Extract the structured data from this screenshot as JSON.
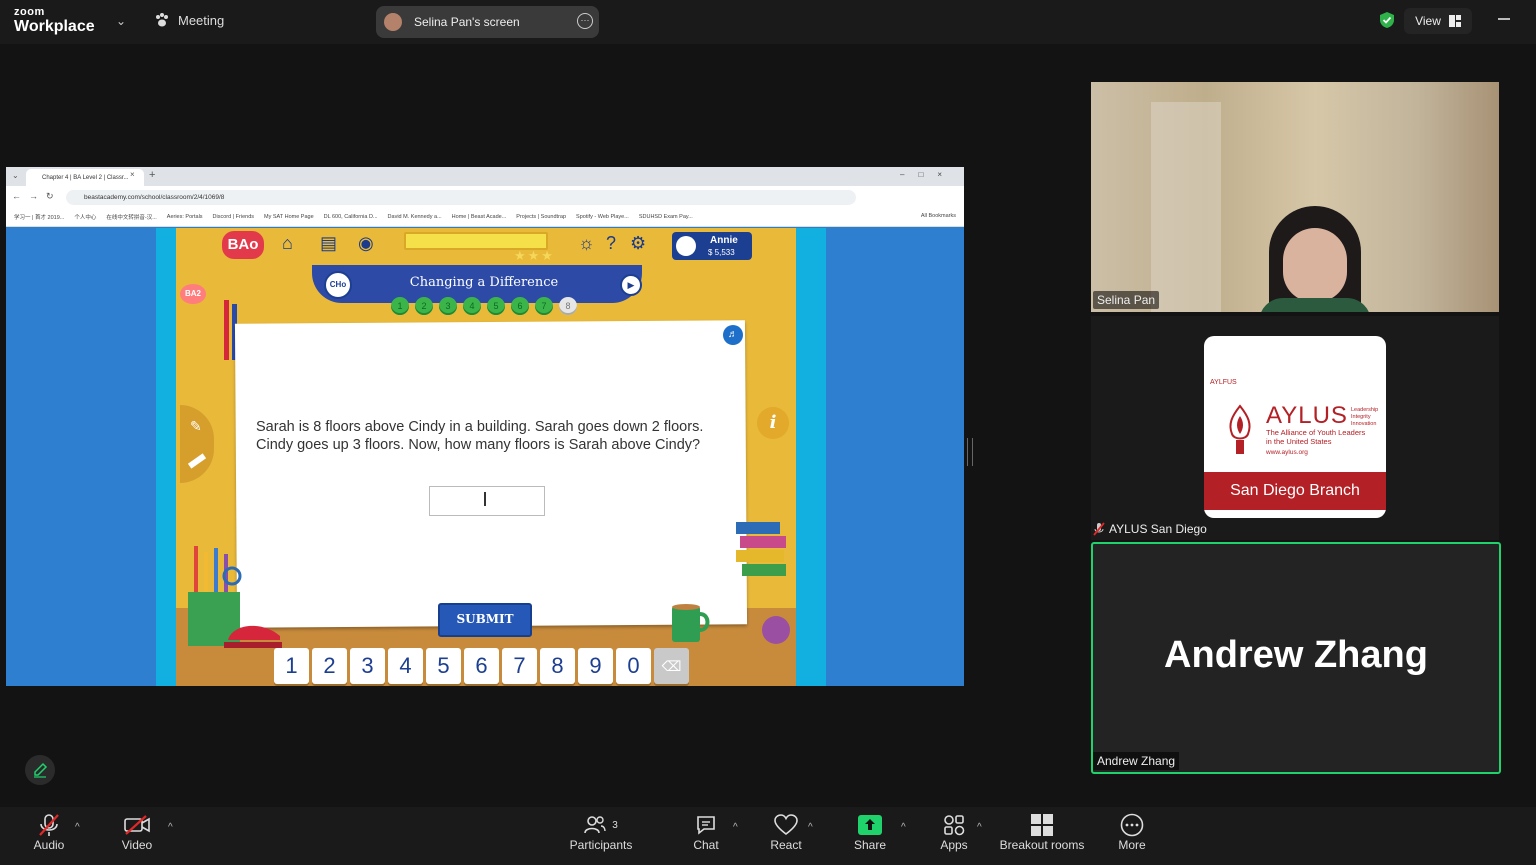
{
  "app": {
    "logo_line1": "zoom",
    "logo_line2": "Workplace"
  },
  "topbar": {
    "meeting_label": "Meeting",
    "screen_share_label": "Selina Pan's screen",
    "view_label": "View",
    "shield_color": "#2fb24a"
  },
  "browser": {
    "tab_title": "Chapter 4 | BA Level 2 | Classr...",
    "url": "beastacademy.com/school/classroom/2/4/1069/8",
    "bookmarks": [
      "学习一 | 首才 2019...",
      "个人中心",
      "在线中文转拼音-汉...",
      "Aeries: Portals",
      "Discord | Friends",
      "My SAT Home Page",
      "DL 600, California D...",
      "David M. Kennedy a...",
      "Home | Beast Acade...",
      "Projects | Soundtrap",
      "Spotify - Web Playe...",
      "SDUHSD Exam Pay..."
    ],
    "all_bookmarks": "All Bookmarks"
  },
  "game": {
    "logo": "BAo",
    "logo2": "BA2",
    "user_name": "Annie",
    "user_money": "$ 5,533",
    "chapter_badge": "CHo",
    "lesson_title": "Changing a Difference",
    "progress_dots": [
      "1",
      "2",
      "3",
      "4",
      "5",
      "6",
      "7",
      "8"
    ],
    "current_dot": "8",
    "question": "Sarah is 8 floors above Cindy in a building. Sarah goes down 2 floors. Cindy goes up 3 floors. Now, how many floors is Sarah above Cindy?",
    "answer_value": "",
    "submit_label": "SUBMIT",
    "keypad": [
      "1",
      "2",
      "3",
      "4",
      "5",
      "6",
      "7",
      "8",
      "9",
      "0"
    ],
    "delete_key": "⌫",
    "info_label": "i"
  },
  "participants": [
    {
      "name": "Selina Pan"
    },
    {
      "name": "AYLUS San Diego",
      "muted": true,
      "card": {
        "small": "AYLFUS",
        "name": "AYLUS",
        "values": [
          "Leadership",
          "Integrity",
          "Innovation"
        ],
        "tagline": [
          "The Alliance of Youth Leaders",
          "in the United States"
        ],
        "url": "www.aylus.org",
        "branch": "San Diego Branch"
      }
    },
    {
      "name": "Andrew Zhang",
      "display_name": "Andrew Zhang",
      "active_speaker_color": "#1fd26c"
    }
  ],
  "toolbar": {
    "audio": "Audio",
    "video": "Video",
    "participants": "Participants",
    "participants_count": "3",
    "chat": "Chat",
    "react": "React",
    "share": "Share",
    "apps": "Apps",
    "breakout": "Breakout rooms",
    "more": "More",
    "share_color": "#1fd26c",
    "muted_color": "#e02828"
  }
}
